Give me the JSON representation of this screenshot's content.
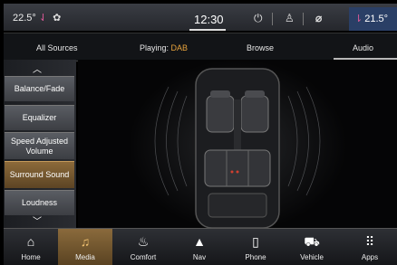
{
  "status": {
    "temp_left": "22.5°",
    "clock": "12:30",
    "temp_right": "21.5°"
  },
  "tabs": [
    {
      "label": "All Sources"
    },
    {
      "label_prefix": "Playing: ",
      "label_highlight": "DAB"
    },
    {
      "label": "Browse"
    },
    {
      "label": "Audio",
      "selected": true
    }
  ],
  "sidebar": {
    "items": [
      {
        "label": "Balance/Fade"
      },
      {
        "label": "Equalizer"
      },
      {
        "label": "Speed Adjusted Volume"
      },
      {
        "label": "Surround Sound",
        "selected": true
      },
      {
        "label": "Loudness"
      }
    ]
  },
  "bottom_nav": [
    {
      "label": "Home",
      "icon": "home-icon"
    },
    {
      "label": "Media",
      "icon": "music-note-icon",
      "selected": true
    },
    {
      "label": "Comfort",
      "icon": "seat-icon"
    },
    {
      "label": "Nav",
      "icon": "navigation-arrow-icon"
    },
    {
      "label": "Phone",
      "icon": "phone-icon"
    },
    {
      "label": "Vehicle",
      "icon": "car-icon"
    },
    {
      "label": "Apps",
      "icon": "apps-grid-icon"
    }
  ],
  "colors": {
    "accent": "#e8a33c",
    "selected_button": "#8c6a3a",
    "temp_right_bg": "#2a3f66"
  }
}
